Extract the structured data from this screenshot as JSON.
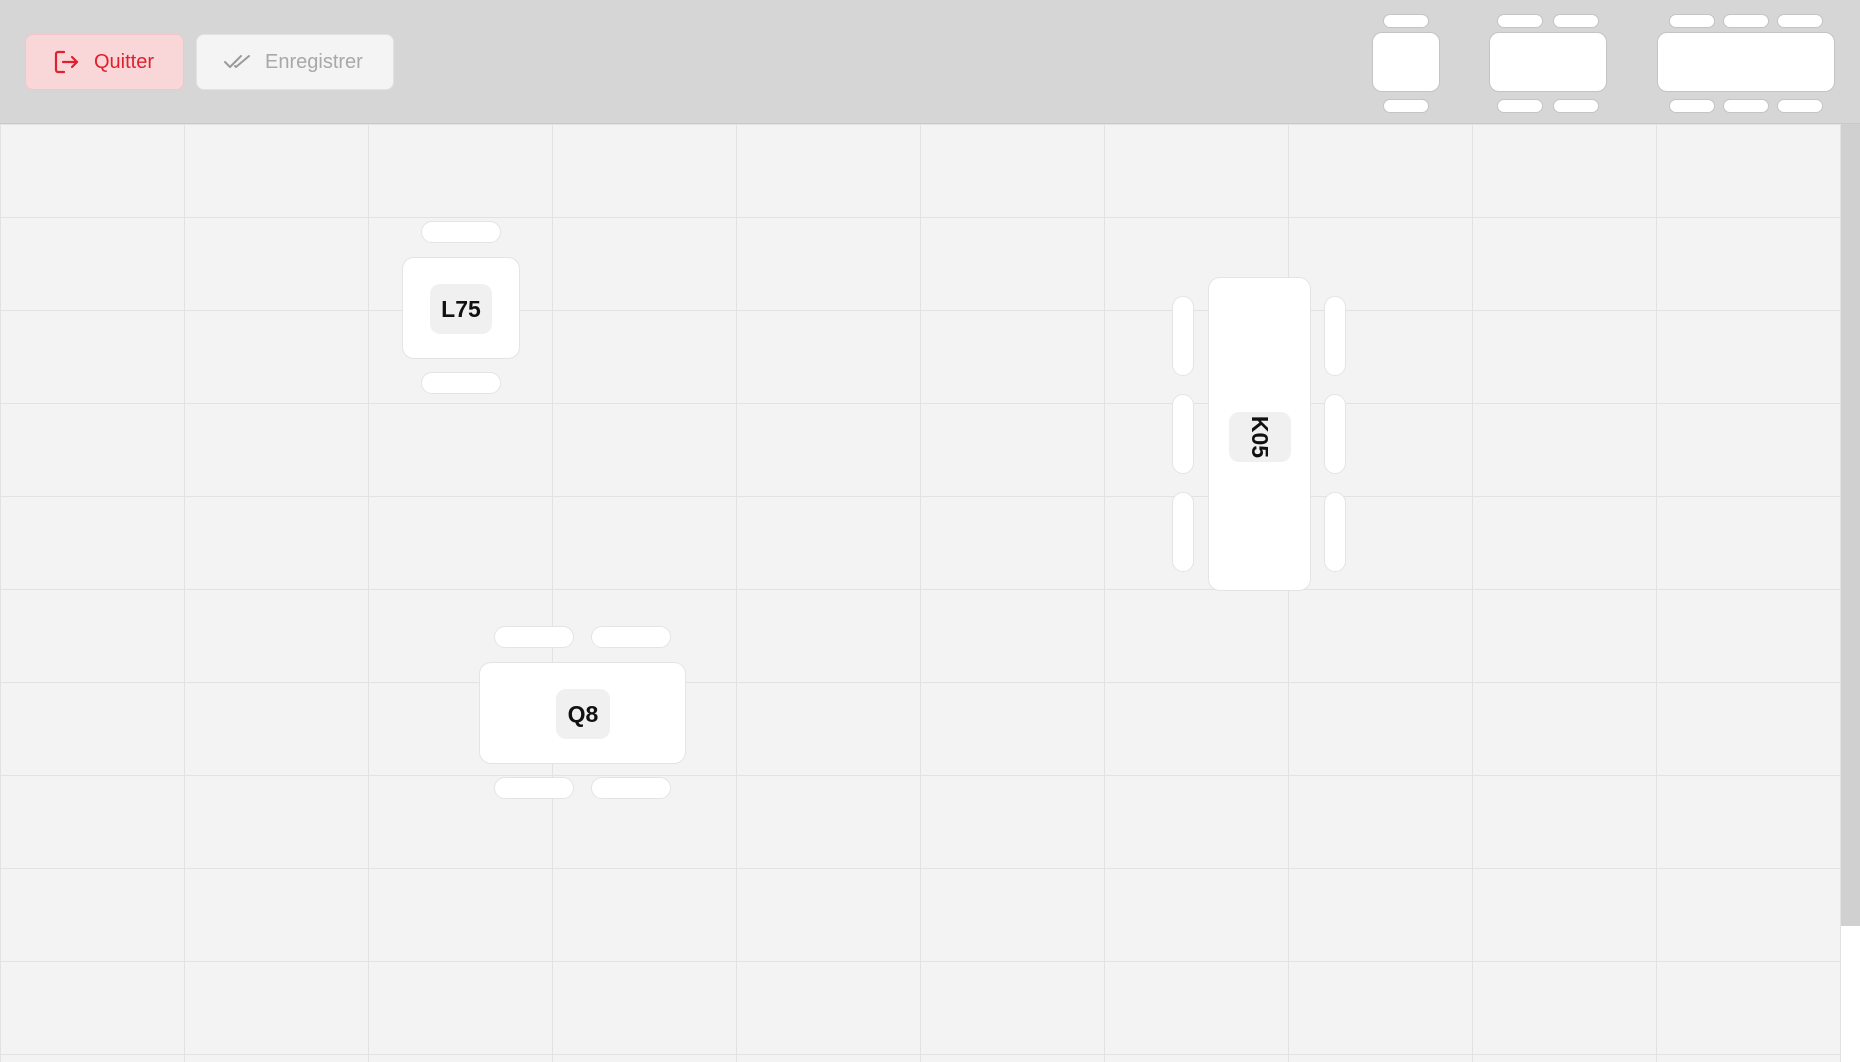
{
  "toolbar": {
    "quit_label": "Quitter",
    "save_label": "Enregistrer",
    "quit_icon": "logout-icon",
    "save_icon": "double-check-icon",
    "palette": [
      "small-table-template",
      "medium-table-template",
      "large-table-template"
    ]
  },
  "colors": {
    "danger": "#e0202f",
    "danger_bg": "#f9d7d9",
    "disabled_text": "#a8a8a8",
    "floor": "#f3f3f3",
    "toolbar": "#d6d6d6"
  },
  "tables": [
    {
      "label": "L75",
      "seats": 2,
      "orientation": "horizontal"
    },
    {
      "label": "K05",
      "seats": 6,
      "orientation": "vertical"
    },
    {
      "label": "Q8",
      "seats": 4,
      "orientation": "horizontal"
    }
  ]
}
